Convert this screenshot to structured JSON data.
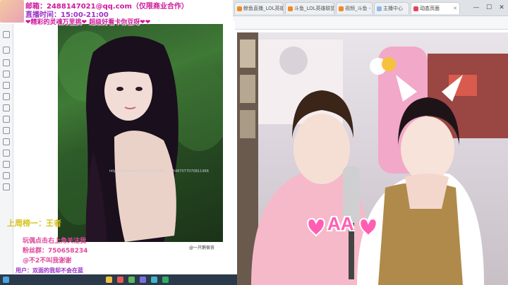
{
  "overlay": {
    "line1": "邮箱：2488147021@qq.com（仅限商业合作）",
    "line2": "直播时间：15:00-21:00",
    "line3": "❤精彩的灵魂万里挑❤ 超级好看卡你豆呀❤❤"
  },
  "tabs": [
    {
      "label": "鲸鱼直播_LOL英雄联盟_斗鱼直播",
      "active": false
    },
    {
      "label": "斗鱼_LOL英雄联盟直播间DOUYU_斗鱼",
      "active": false
    },
    {
      "label": "视频_斗鱼 - 斗鱼直播",
      "active": false
    },
    {
      "label": "主播中心",
      "active": false
    },
    {
      "label": "动态页面",
      "active": true
    }
  ],
  "window_controls": [
    "—",
    "☐",
    "✕"
  ],
  "photo_viewer": {
    "url": "https://www.douyu.com/222227_~15487077070B11466",
    "watermark": "@一只鹅很丧"
  },
  "bottom_panel": {
    "rank_title": "上周榜一：王者",
    "line_a": "玩偶点击右上角关注我",
    "line_b": "粉丝群：750658234",
    "line_c": "@不2不叫我谢谢",
    "bottom_user": "用户：双面的我却不会在蓝"
  },
  "stream": {
    "sticker_text": "AA"
  },
  "colors": {
    "overlay_magenta": "#d0169a",
    "overlay_purple": "#9b2fc7",
    "panel_yellow": "#d6c21a",
    "panel_pink": "#e0479c",
    "sticker_pink": "#ff5fb3"
  },
  "sidebar_icons": [
    "star-icon",
    "box-icon",
    "home-icon",
    "grid-icon",
    "chat-icon",
    "list-icon",
    "person-icon",
    "cloud-icon",
    "folder-icon",
    "shield-icon",
    "gear-icon",
    "mail-icon",
    "tag-icon",
    "doc-icon"
  ]
}
